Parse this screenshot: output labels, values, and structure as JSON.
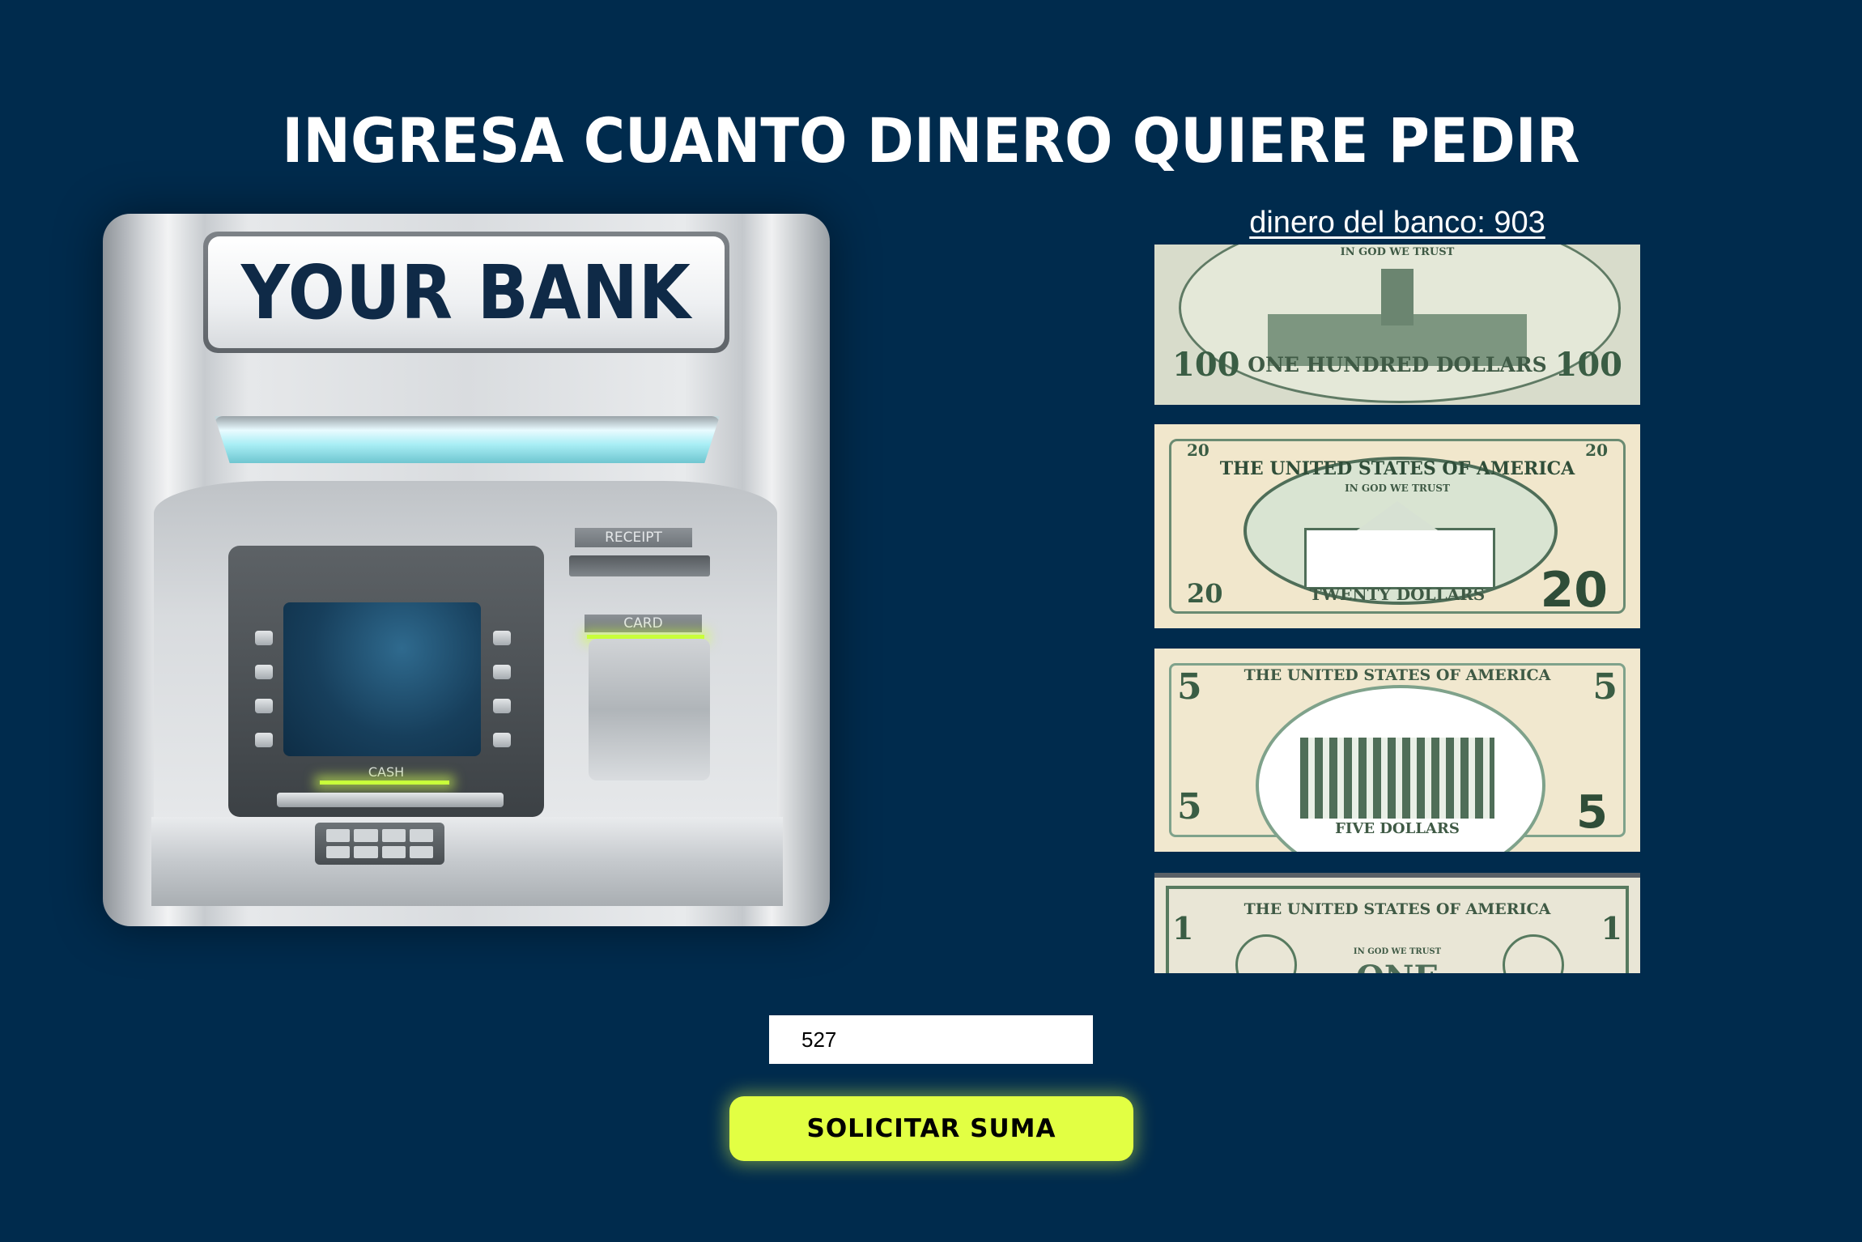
{
  "header": {
    "title": "INGRESA CUANTO DINERO QUIERE PEDIR"
  },
  "atm": {
    "bank_name": "YOUR BANK",
    "receipt_label": "RECEIPT",
    "card_label": "CARD",
    "cash_label": "CASH"
  },
  "bank": {
    "balance_text": "dinero del banco: 903"
  },
  "bills": [
    {
      "denomination": "100",
      "top_text": "IN GOD     WE TRUST",
      "bottom_text": "ONE HUNDRED DOLLARS"
    },
    {
      "denomination": "20",
      "top_text": "THE UNITED STATES OF AMERICA",
      "motto": "IN GOD     WE TRUST",
      "bottom_text": "TWENTY DOLLARS"
    },
    {
      "denomination": "5",
      "top_text": "THE UNITED STATES OF AMERICA",
      "bottom_text": "FIVE DOLLARS"
    },
    {
      "denomination": "1",
      "top_text": "THE UNITED STATES OF AMERICA",
      "motto": "IN GOD WE TRUST",
      "corner_text": "ONE"
    }
  ],
  "form": {
    "amount_value": "527",
    "submit_label": "SOLICITAR SUMA"
  },
  "colors": {
    "background": "#002b4d",
    "button": "#e2ff43",
    "title": "#ffffff"
  }
}
